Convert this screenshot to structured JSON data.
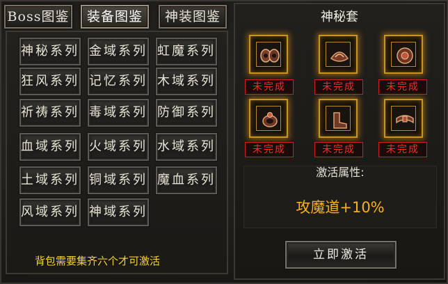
{
  "tabs": [
    {
      "label": "Boss图鉴",
      "active": false
    },
    {
      "label": "装备图鉴",
      "active": true
    },
    {
      "label": "神装图鉴",
      "active": false
    }
  ],
  "series": [
    {
      "label": "神秘系列"
    },
    {
      "label": "金域系列"
    },
    {
      "label": "虹魔系列"
    },
    {
      "label": "狂风系列"
    },
    {
      "label": "记忆系列"
    },
    {
      "label": "木域系列"
    },
    {
      "label": "祈祷系列"
    },
    {
      "label": "毒域系列"
    },
    {
      "label": "防御系列"
    },
    {
      "label": "血域系列"
    },
    {
      "label": "火域系列"
    },
    {
      "label": "水域系列"
    },
    {
      "label": "土域系列"
    },
    {
      "label": "铜域系列"
    },
    {
      "label": "魔血系列"
    },
    {
      "label": "风域系列"
    },
    {
      "label": "神域系列"
    }
  ],
  "hint": "背包需要集齐六个才可激活",
  "set": {
    "title": "神秘套",
    "items": [
      {
        "icon": "bracelet-icon",
        "status": "未完成"
      },
      {
        "icon": "helmet-icon",
        "status": "未完成"
      },
      {
        "icon": "necklace-icon",
        "status": "未完成"
      },
      {
        "icon": "ring-icon",
        "status": "未完成"
      },
      {
        "icon": "boots-icon",
        "status": "未完成"
      },
      {
        "icon": "belt-icon",
        "status": "未完成"
      }
    ],
    "attr_header": "激活属性:",
    "attr_value": "攻魔道+10%",
    "activate_label": "立即激活"
  },
  "colors": {
    "status_red": "#ff2a20",
    "gold_glow": "#c99520",
    "hint_yellow": "#f2d232",
    "attr_orange": "#f7b21a"
  }
}
